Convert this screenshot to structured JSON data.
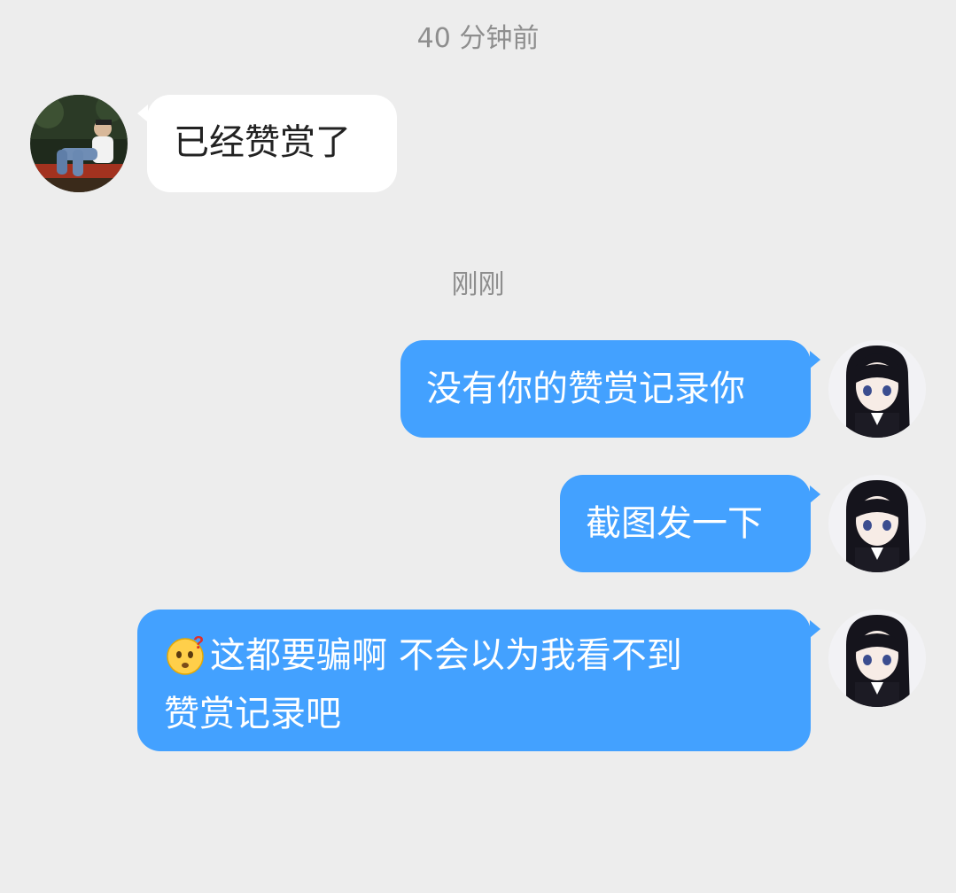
{
  "chat": {
    "time_1": "40 分钟前",
    "time_2": "刚刚",
    "messages": [
      {
        "sender": "other",
        "text": "已经赞赏了"
      },
      {
        "sender": "me",
        "text": "没有你的赞赏记录你"
      },
      {
        "sender": "me",
        "text": "截图发一下"
      },
      {
        "sender": "me",
        "emoji": "thinking-face-question-emoji",
        "line_1": "这都要骗啊 不会以为我看不到",
        "line_2": "赞赏记录吧"
      }
    ]
  },
  "colors": {
    "background": "#ededed",
    "incoming_bubble": "#ffffff",
    "outgoing_bubble": "#43a1ff",
    "timestamp_text": "#8e8e8e"
  }
}
